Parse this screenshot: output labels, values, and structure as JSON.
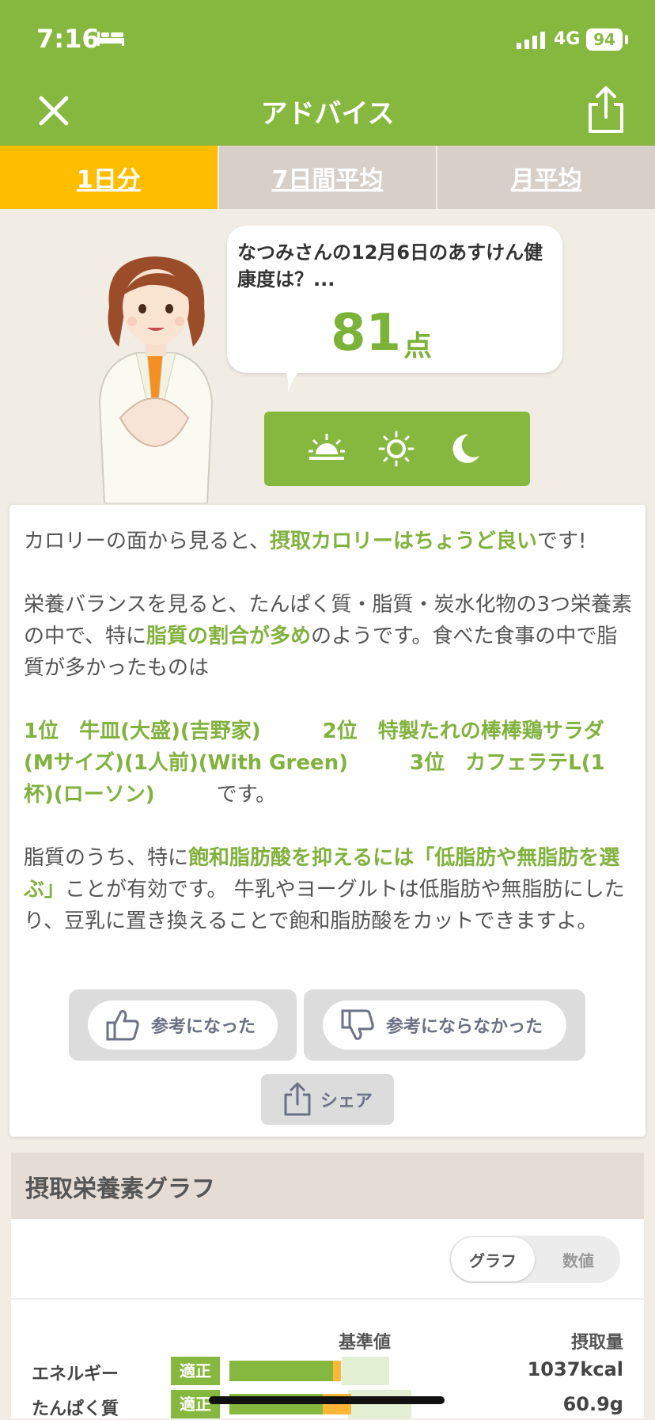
{
  "status": {
    "time": "7:16",
    "network": "4G",
    "battery": "94"
  },
  "header": {
    "title": "アドバイス"
  },
  "tabs": [
    {
      "label": "1日分"
    },
    {
      "label": "7日間平均"
    },
    {
      "label": "月平均"
    }
  ],
  "advice": {
    "bubble_line": "なつみさんの12月6日のあすけん健康度は？...",
    "score": "81",
    "score_unit": "点"
  },
  "message": {
    "p1_a": "カロリーの面から見ると、",
    "p1_b": "摂取カロリーはちょうど良い",
    "p1_c": "です!",
    "p2_a": "栄養バランスを見ると、たんぱく質・脂質・炭水化物の3つ栄養素の中で、特に",
    "p2_b": "脂質の割合が多め",
    "p2_c": "のようです。食べた食事の中で脂質が多かったものは",
    "rank1": "1位　牛皿(大盛)(吉野家)",
    "rank2": "2位　特製たれの棒棒鶏サラダ(Mサイズ)(1人前)(With Green)",
    "rank3": "3位　カフェラテL(1杯)(ローソン)",
    "ranks_tail": "です。",
    "p4_a": "脂質のうち、特に",
    "p4_b": "飽和脂肪酸を抑えるには「低脂肪や無脂肪を選ぶ」",
    "p4_c": "ことが有効です。 牛乳やヨーグルトは低脂肪や無脂肪にしたり、豆乳に置き換えることで飽和脂肪酸をカットできますよ。"
  },
  "feedback": {
    "helpful": "参考になった",
    "not_helpful": "参考にならなかった",
    "share": "シェア"
  },
  "graph": {
    "title": "摂取栄養素グラフ",
    "toggle": [
      "グラフ",
      "数値"
    ],
    "col_ref": "基準値",
    "col_intake": "摂取量",
    "rows": [
      {
        "label": "エネルギー",
        "status": "適正",
        "value": "1037kcal",
        "fill": 0.88
      },
      {
        "label": "たんぱく質",
        "status": "適正",
        "value": "60.9g",
        "fill": 0.96
      }
    ]
  },
  "colors": {
    "brand": "#86b83f",
    "tab_active": "#ffbd00",
    "highlight": "#80b23d"
  }
}
